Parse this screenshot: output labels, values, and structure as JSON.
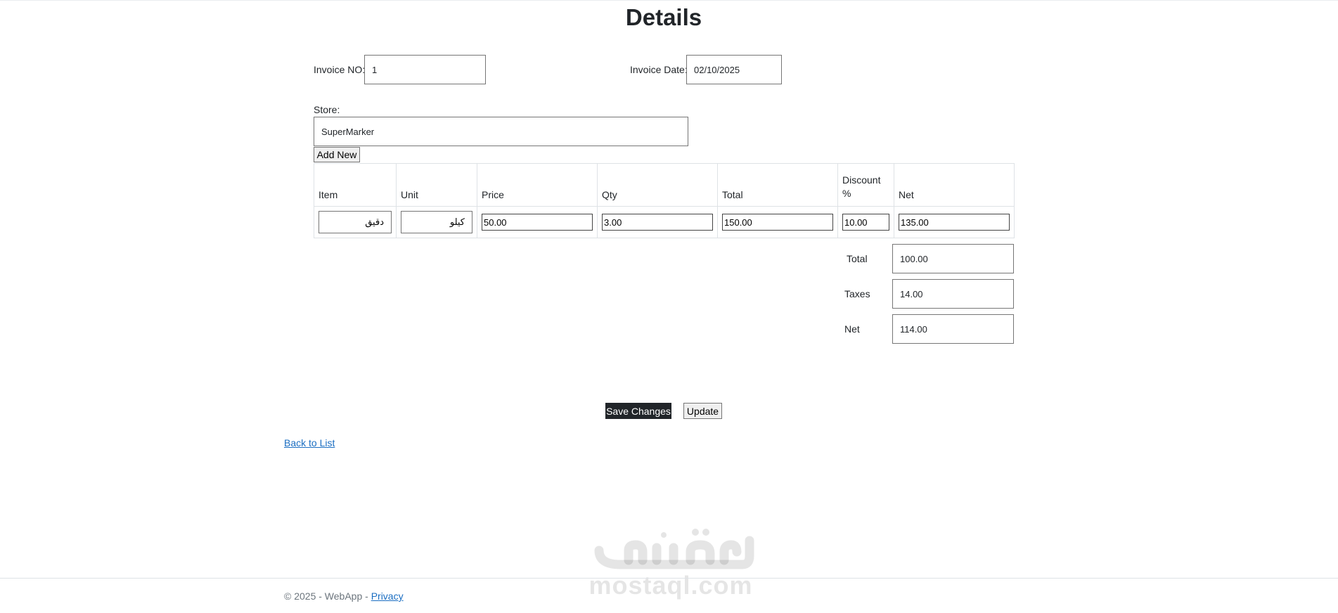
{
  "page": {
    "title": "Details"
  },
  "form": {
    "invoice_no_label": "Invoice NO:",
    "invoice_no_value": "1",
    "invoice_date_label": "Invoice Date:",
    "invoice_date_value": "02/10/2025",
    "store_label": "Store:",
    "store_value": "SuperMarker",
    "add_new_label": "Add New"
  },
  "table": {
    "headers": [
      "Item",
      "Unit",
      "Price",
      "Qty",
      "Total",
      "Discount %",
      "Net"
    ],
    "rows": [
      {
        "item": "دقيق",
        "unit": "كيلو",
        "price": "50.00",
        "qty": "3.00",
        "total": "150.00",
        "discount": "10.00",
        "net": "135.00"
      }
    ]
  },
  "summary": {
    "total_label": "Total",
    "total_value": "100.00",
    "taxes_label": "Taxes",
    "taxes_value": "14.00",
    "net_label": "Net",
    "net_value": "114.00"
  },
  "actions": {
    "save_label": "Save Changes",
    "update_label": "Update"
  },
  "links": {
    "back_label": "Back to List"
  },
  "footer": {
    "copyright": "© 2025 - WebApp - ",
    "privacy_label": "Privacy"
  },
  "watermark": {
    "text": "mostaql.com"
  },
  "colors": {
    "link": "#1b6ec2",
    "dark_button": "#212529",
    "text": "#212529"
  }
}
